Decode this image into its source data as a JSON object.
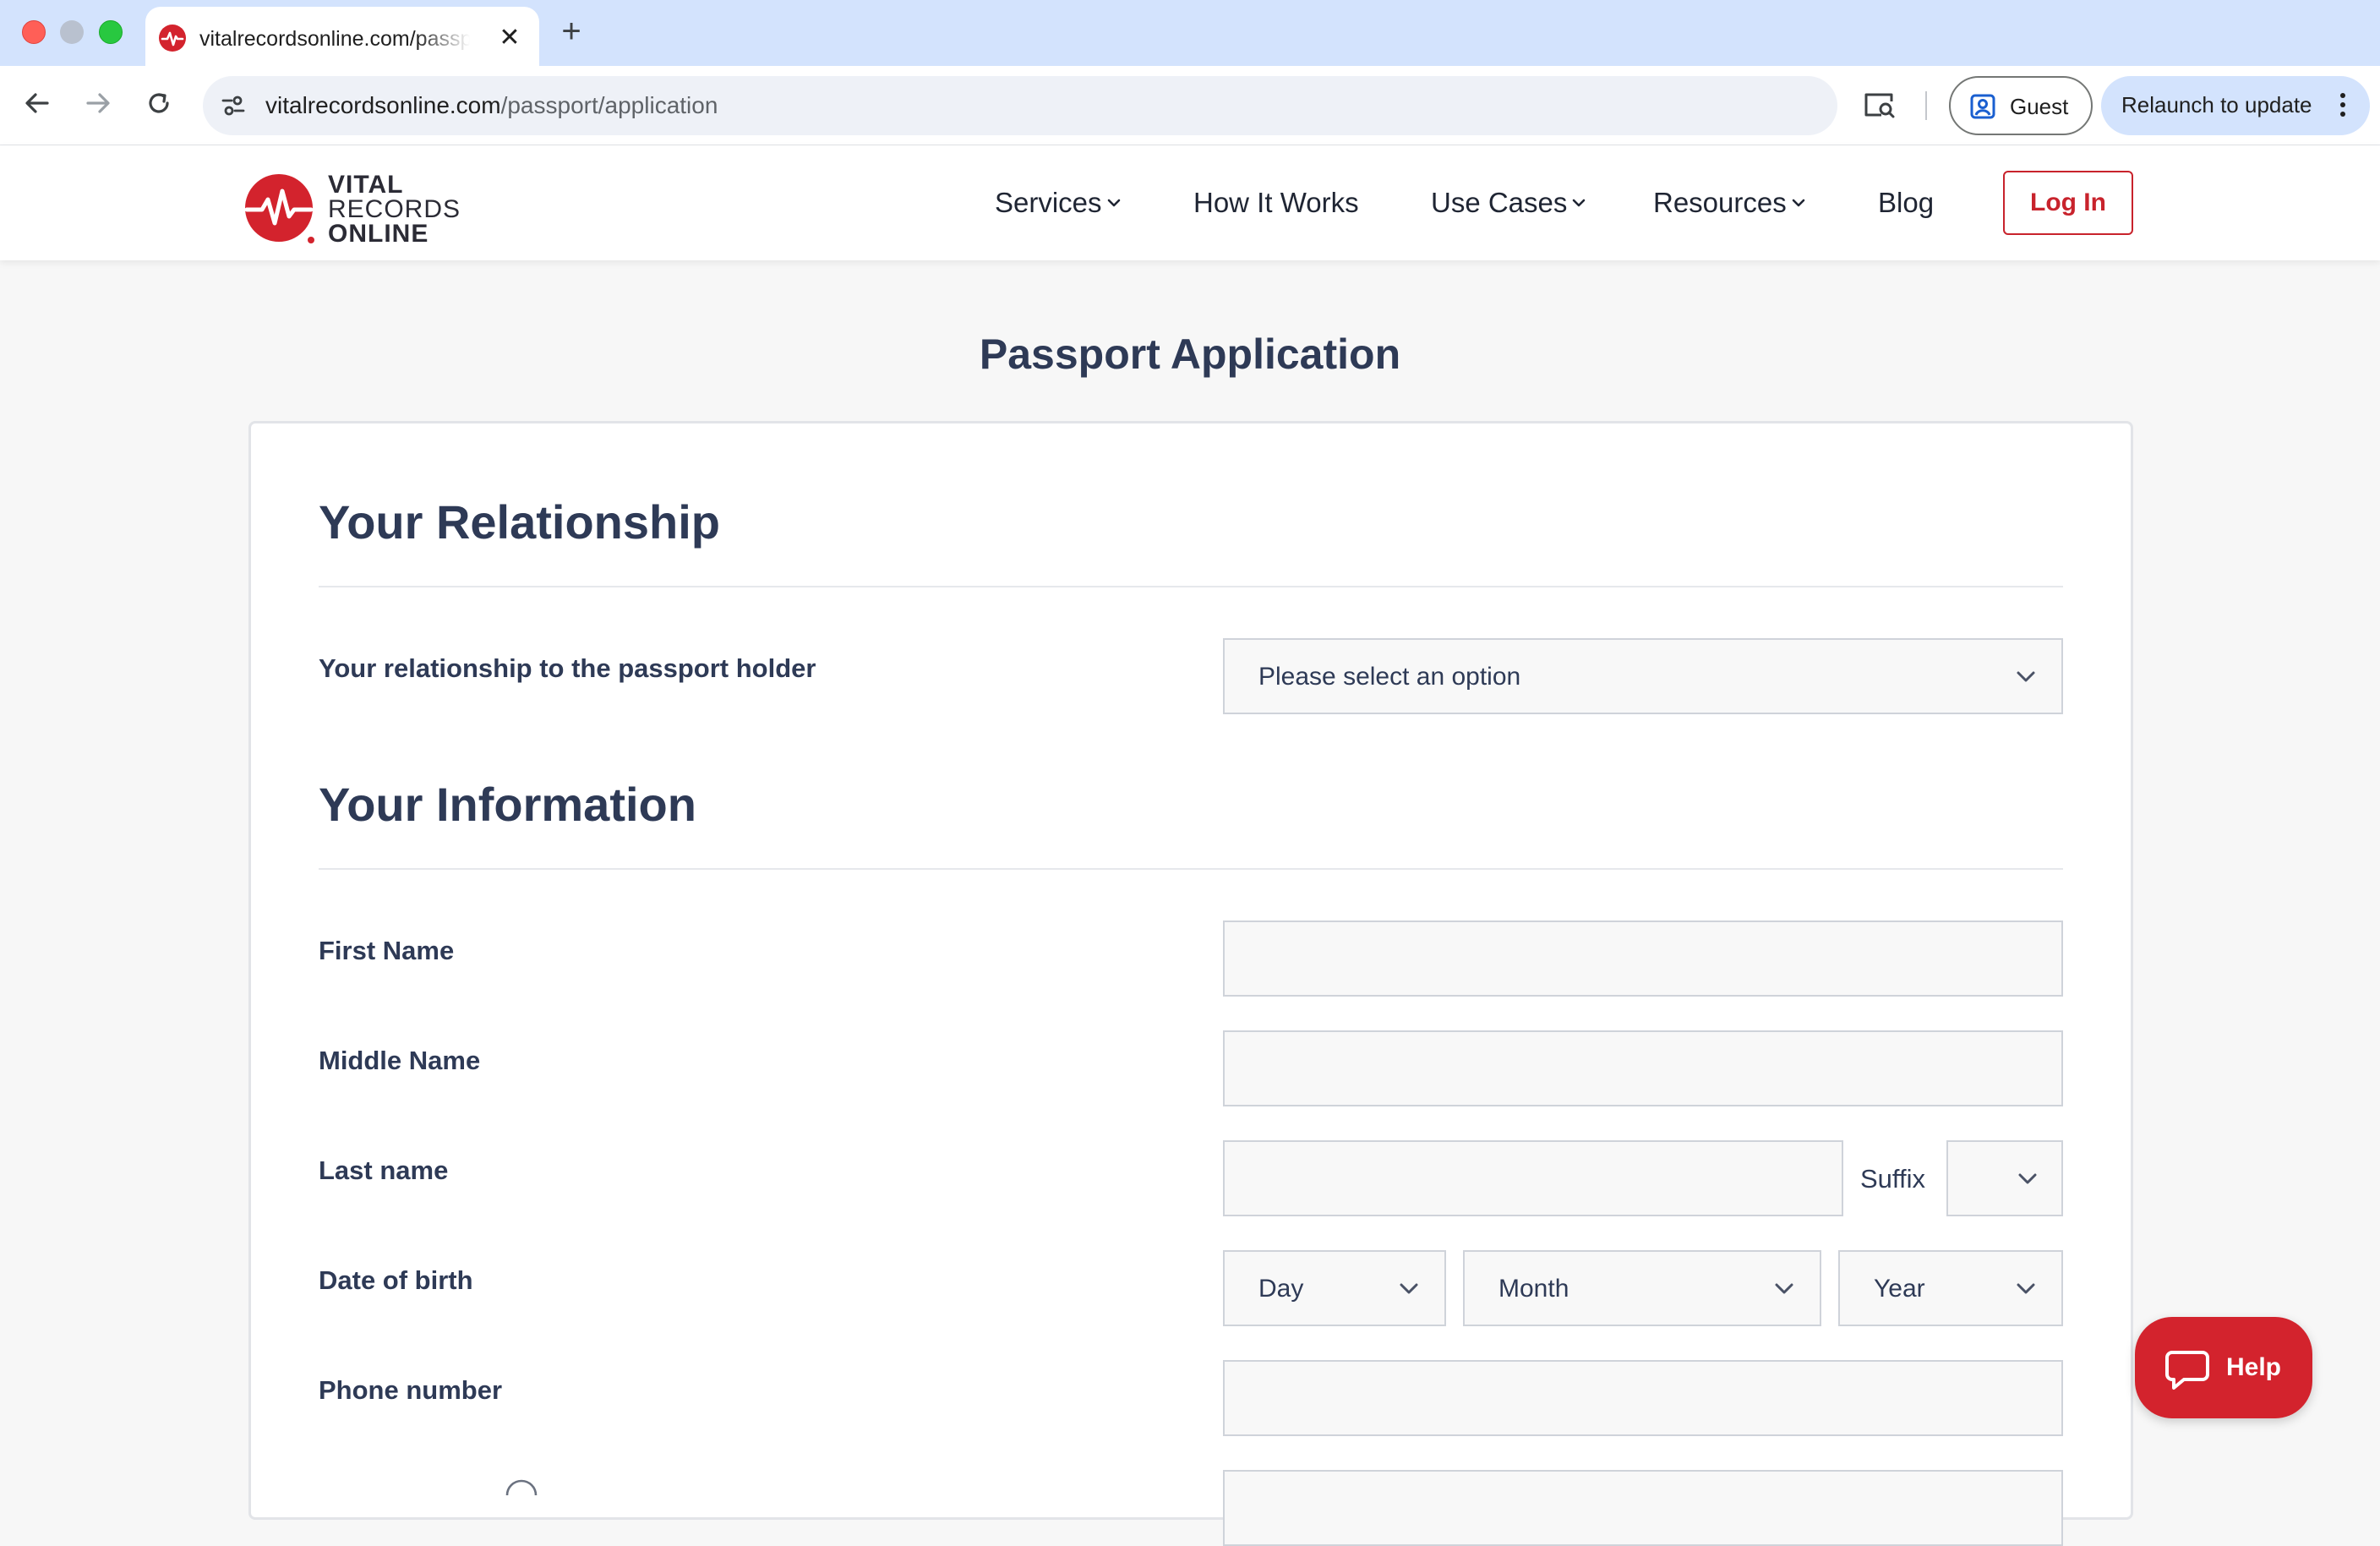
{
  "browser": {
    "tab": {
      "title": "vitalrecordsonline.com/passport/application",
      "close": "✕"
    },
    "new_tab": "+",
    "url": {
      "host": "vitalrecordsonline.com",
      "path": "/passport/application"
    },
    "guest_label": "Guest",
    "relaunch_label": "Relaunch to update"
  },
  "site": {
    "logo": {
      "line1": "VITAL",
      "line2": "RECORDS",
      "line3": "ONLINE"
    },
    "nav": {
      "services": "Services",
      "how_it_works": "How It Works",
      "use_cases": "Use Cases",
      "resources": "Resources",
      "blog": "Blog",
      "login": "Log In"
    },
    "brand_color": "#d3232d"
  },
  "page": {
    "title": "Passport Application",
    "sections": {
      "relationship": {
        "title": "Your Relationship",
        "relationship_label": "Your relationship to the passport holder",
        "relationship_select": "Please select an option"
      },
      "information": {
        "title": "Your Information",
        "first_name_label": "First Name",
        "first_name_value": "",
        "middle_name_label": "Middle Name",
        "middle_name_value": "",
        "last_name_label": "Last name",
        "last_name_value": "",
        "suffix_label": "Suffix",
        "suffix_value": "",
        "dob_label": "Date of birth",
        "dob_day": "Day",
        "dob_month": "Month",
        "dob_year": "Year",
        "phone_label": "Phone number",
        "phone_value": ""
      }
    }
  },
  "help": {
    "label": "Help"
  }
}
